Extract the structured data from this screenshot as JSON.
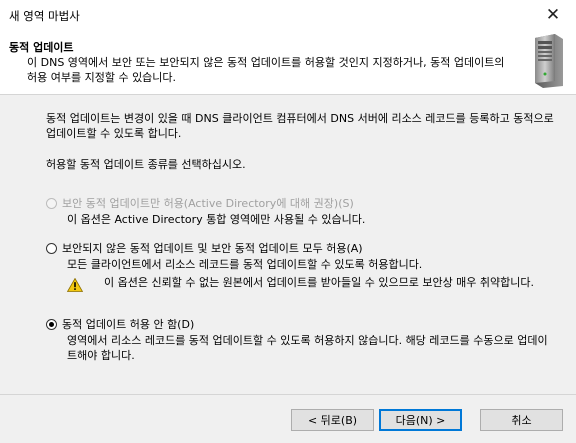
{
  "window": {
    "title": "새 영역 마법사"
  },
  "header": {
    "title": "동적 업데이트",
    "description": "이 DNS 영역에서 보안 또는 보안되지 않은 동적 업데이트를 허용할 것인지 지정하거나, 동적 업데이트의 허용 여부를 지정할 수 있습니다."
  },
  "body": {
    "intro": "동적 업데이트는 변경이 있을 때 DNS 클라이언트 컴퓨터에서 DNS 서버에 리소스 레코드를 등록하고 동적으로 업데이트할 수 있도록 합니다.",
    "choose_prompt": "허용할 동적 업데이트 종류를 선택하십시오.",
    "options": [
      {
        "label": "보안 동적 업데이트만 허용(Active Directory에 대해 권장)(S)",
        "description": "이 옵션은 Active Directory 통합 영역에만 사용될 수 있습니다.",
        "enabled": false,
        "selected": false
      },
      {
        "label": "보안되지 않은 동적 업데이트 및 보안 동적 업데이트 모두 허용(A)",
        "description": "모든 클라이언트에서 리소스 레코드를 동적 업데이트할 수 있도록 허용합니다.",
        "warning": "이 옵션은 신뢰할 수 없는 원본에서 업데이트를 받아들일 수 있으므로 보안상 매우 취약합니다.",
        "enabled": true,
        "selected": false
      },
      {
        "label": "동적 업데이트 허용 안 함(D)",
        "description": "영역에서 리소스 레코드를 동적 업데이트할 수 있도록 허용하지 않습니다. 해당 레코드를 수동으로 업데이트해야 합니다.",
        "enabled": true,
        "selected": true
      }
    ]
  },
  "buttons": {
    "back": "< 뒤로(B)",
    "next": "다음(N) >",
    "cancel": "취소"
  },
  "icons": {
    "close": "close-icon",
    "server": "server-icon",
    "warning": "warning-icon"
  },
  "colors": {
    "accent": "#0078d7",
    "warning": "#f2c811"
  }
}
